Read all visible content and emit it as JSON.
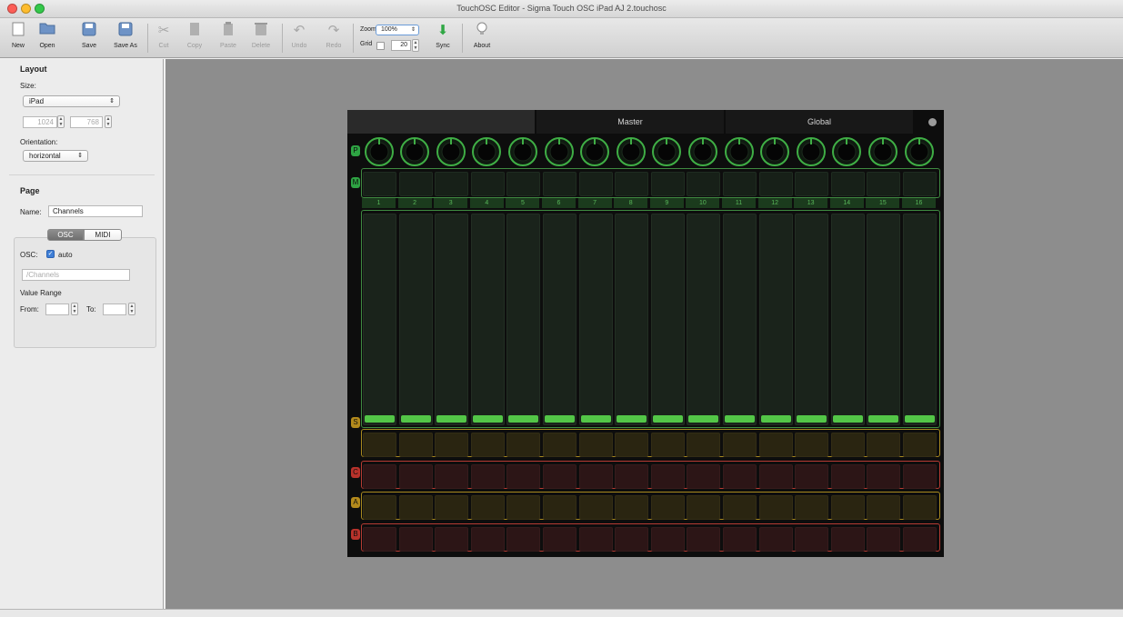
{
  "window": {
    "title": "TouchOSC Editor - Sigma Touch OSC iPad AJ 2.touchosc"
  },
  "toolbar": {
    "buttons": [
      {
        "label": "New",
        "icon": "new-document-icon"
      },
      {
        "label": "Open",
        "icon": "folder-icon"
      },
      {
        "label": "Save",
        "icon": "save-icon"
      },
      {
        "label": "Save As",
        "icon": "save-as-icon"
      },
      {
        "label": "Cut",
        "icon": "scissors-icon"
      },
      {
        "label": "Copy",
        "icon": "copy-icon"
      },
      {
        "label": "Paste",
        "icon": "paste-icon"
      },
      {
        "label": "Delete",
        "icon": "delete-icon"
      },
      {
        "label": "Undo",
        "icon": "undo-icon"
      },
      {
        "label": "Redo",
        "icon": "redo-icon"
      },
      {
        "label": "Sync",
        "icon": "sync-arrow-icon"
      },
      {
        "label": "About",
        "icon": "lightbulb-icon"
      }
    ],
    "zoom_label": "Zoom",
    "zoom_value": "100%",
    "grid_label": "Grid",
    "grid_value": "20"
  },
  "sidebar": {
    "layout_heading": "Layout",
    "size_label": "Size:",
    "size_value": "iPad",
    "width_value": "1024",
    "height_value": "768",
    "orientation_label": "Orientation:",
    "orientation_value": "horizontal",
    "page_heading": "Page",
    "name_label": "Name:",
    "name_value": "Channels",
    "tab_osc": "OSC",
    "tab_midi": "MIDI",
    "osc_label": "OSC:",
    "auto_label": "auto",
    "osc_path_placeholder": "/Channels",
    "value_range_label": "Value Range",
    "from_label": "From:",
    "to_label": "To:"
  },
  "device": {
    "tabs": [
      "",
      "Master",
      "Global"
    ],
    "row_letters": [
      "P",
      "M",
      "S",
      "C",
      "A",
      "B"
    ],
    "channel_numbers": [
      "1",
      "2",
      "3",
      "4",
      "5",
      "6",
      "7",
      "8",
      "9",
      "10",
      "11",
      "12",
      "13",
      "14",
      "15",
      "16"
    ],
    "colors": {
      "green": "#53c647",
      "yellow": "#a98a1f",
      "red": "#b73b33"
    }
  }
}
